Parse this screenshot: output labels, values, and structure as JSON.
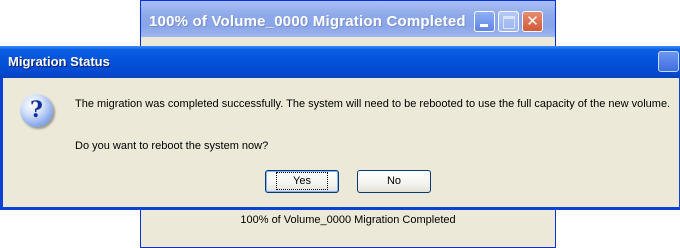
{
  "background_window": {
    "title": "100% of Volume_0000 Migration Completed",
    "status_text": "100% of Volume_0000 Migration Completed",
    "close_glyph": "✕"
  },
  "dialog": {
    "title": "Migration Status",
    "icon": "question-icon",
    "icon_glyph": "?",
    "message": "The migration was completed successfully. The system will need to be rebooted to use the full capacity of the new volume.",
    "question": "Do you want to reboot the system now?",
    "buttons": {
      "yes": "Yes",
      "no": "No"
    }
  },
  "colors": {
    "dialog_titlebar": "#0352d9",
    "background_titlebar": "#8ea9ea",
    "window_face": "#ece9d8"
  }
}
